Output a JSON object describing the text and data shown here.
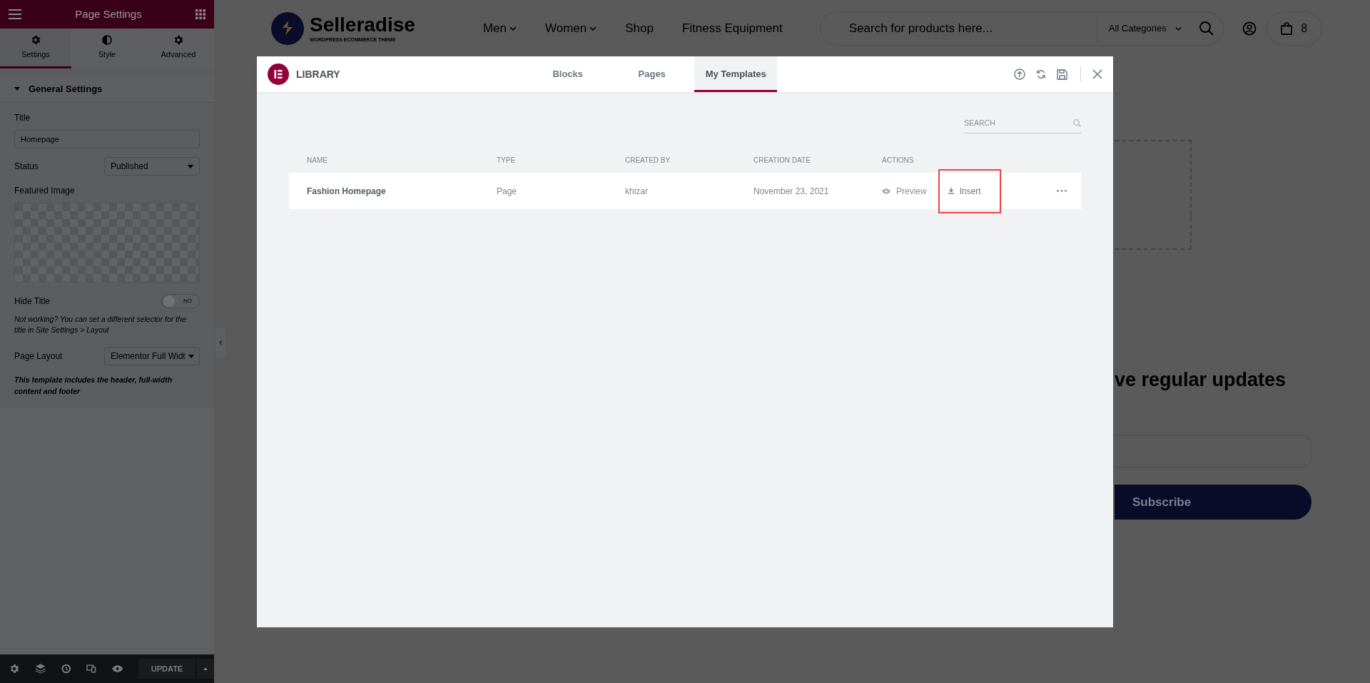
{
  "editor_panel": {
    "title": "Page Settings",
    "tabs": [
      {
        "label": "Settings",
        "kind": "gear",
        "selected": true
      },
      {
        "label": "Style",
        "kind": "contrast",
        "selected": false
      },
      {
        "label": "Advanced",
        "kind": "gear",
        "selected": false
      }
    ],
    "section": {
      "title": "General Settings",
      "expanded": true
    },
    "title_field": {
      "label": "Title",
      "value": "Homepage"
    },
    "status_field": {
      "label": "Status",
      "value": "Published"
    },
    "featured_image": {
      "label": "Featured Image"
    },
    "hide_title": {
      "label": "Hide Title",
      "on": false,
      "state_text": "NO",
      "note": "Not working? You can set a different selector for the title in Site Settings > Layout"
    },
    "page_layout": {
      "label": "Page Layout",
      "value": "Elementor Full Widt",
      "note": "This template includes the header, full-width content and footer"
    },
    "update_button": "UPDATE"
  },
  "site_header": {
    "logo": {
      "name": "Selleradise",
      "tagline": "WORDPRESS ECOMMERCE THEME"
    },
    "nav": [
      {
        "label": "Men",
        "dropdown": true
      },
      {
        "label": "Women",
        "dropdown": true
      },
      {
        "label": "Shop",
        "dropdown": false
      },
      {
        "label": "Fitness Equipment",
        "dropdown": false
      }
    ],
    "search": {
      "placeholder": "Search for products here...",
      "category": "All Categories"
    },
    "cart_count": "8"
  },
  "page": {
    "heading": "ve regular updates",
    "subscribe_button": "Subscribe"
  },
  "library": {
    "title": "LIBRARY",
    "tabs": [
      {
        "label": "Blocks",
        "selected": false
      },
      {
        "label": "Pages",
        "selected": false
      },
      {
        "label": "My Templates",
        "selected": true
      }
    ],
    "search": {
      "placeholder": "SEARCH"
    },
    "columns": [
      "NAME",
      "TYPE",
      "CREATED BY",
      "CREATION DATE",
      "ACTIONS"
    ],
    "rows": [
      {
        "name": "Fashion Homepage",
        "type": "Page",
        "created_by": "khizar",
        "date": "November 23, 2021",
        "preview": "Preview",
        "insert": "Insert",
        "insert_highlighted": true
      }
    ]
  }
}
